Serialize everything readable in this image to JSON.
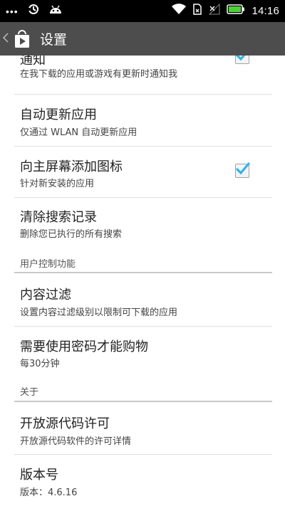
{
  "status_bar": {
    "dots": "•••",
    "time": "14:16"
  },
  "action_bar": {
    "title": "设置"
  },
  "settings": {
    "notify": {
      "title": "通知",
      "subtitle": "在我下载的应用或游戏有更新时通知我",
      "checked": true
    },
    "auto_update": {
      "title": "自动更新应用",
      "subtitle": "仅通过 WLAN 自动更新应用"
    },
    "add_icon": {
      "title": "向主屏幕添加图标",
      "subtitle": "针对新安装的应用",
      "checked": true
    },
    "clear_history": {
      "title": "清除搜索记录",
      "subtitle": "删除您已执行的所有搜索"
    }
  },
  "user_controls": {
    "header": "用户控制功能",
    "content_filter": {
      "title": "内容过滤",
      "subtitle": "设置内容过滤级别以限制可下载的应用"
    },
    "password": {
      "title": "需要使用密码才能购物",
      "subtitle": "每30分钟"
    }
  },
  "about": {
    "header": "关于",
    "licenses": {
      "title": "开放源代码许可",
      "subtitle": "开放源代码软件的许可详情"
    },
    "version": {
      "title": "版本号",
      "subtitle": "版本：4.6.16"
    }
  },
  "colors": {
    "action_bar": "#4d4d4d",
    "check_accent": "#33b5e5"
  }
}
